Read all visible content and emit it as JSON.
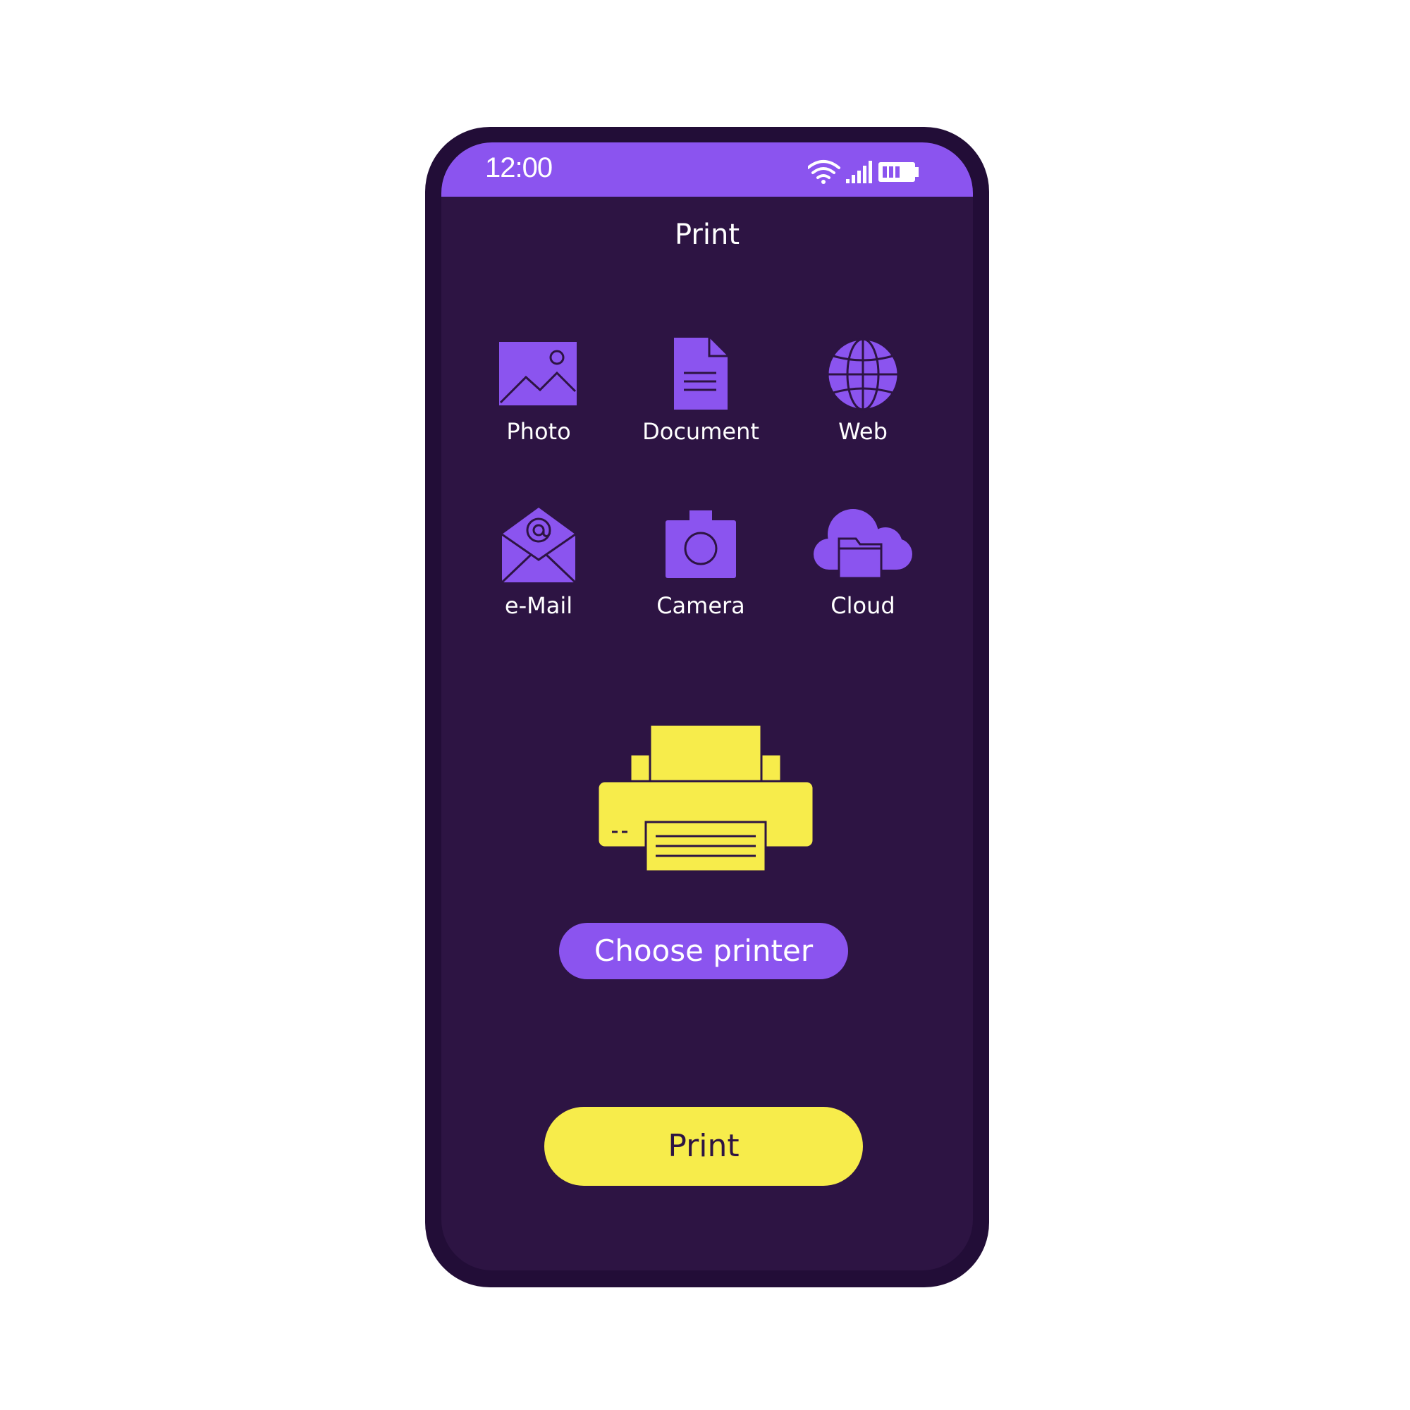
{
  "status_bar": {
    "time": "12:00",
    "icons": [
      "wifi-icon",
      "signal-icon",
      "battery-icon"
    ]
  },
  "header": {
    "title": "Print"
  },
  "sources": [
    {
      "label": "Photo",
      "icon": "photo-icon"
    },
    {
      "label": "Document",
      "icon": "document-icon"
    },
    {
      "label": "Web",
      "icon": "globe-icon"
    },
    {
      "label": "e-Mail",
      "icon": "email-icon"
    },
    {
      "label": "Camera",
      "icon": "camera-icon"
    },
    {
      "label": "Cloud",
      "icon": "cloud-folder-icon"
    }
  ],
  "printer": {
    "icon": "printer-icon",
    "choose_label": "Choose printer"
  },
  "actions": {
    "print_label": "Print"
  },
  "colors": {
    "phone_frame": "#220d37",
    "screen_bg": "#2d1443",
    "accent_purple": "#8b54ef",
    "accent_yellow": "#f7ec4b",
    "text": "#ffffff"
  }
}
